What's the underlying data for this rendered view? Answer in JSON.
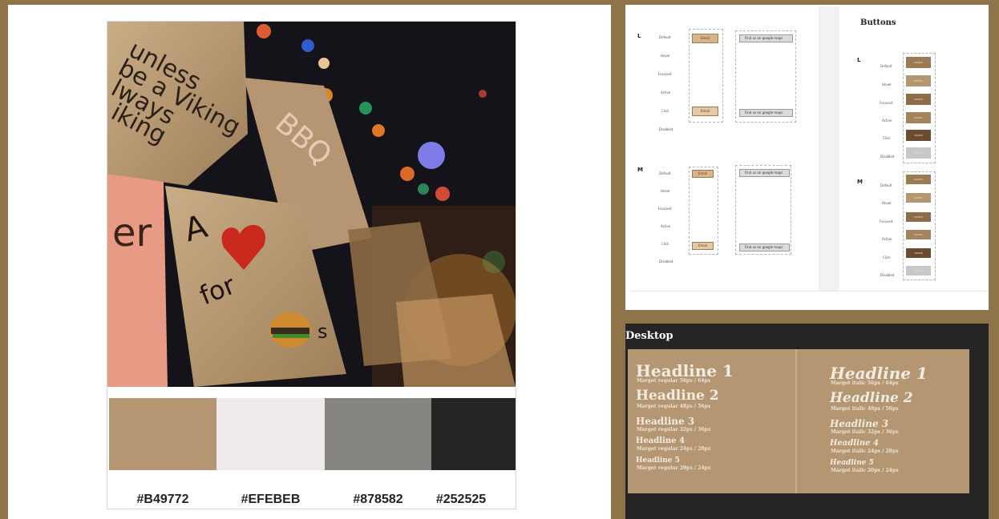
{
  "palette": {
    "swatches": [
      {
        "hex": "#B49772",
        "color": "#b49772"
      },
      {
        "hex": "#EFEBEB",
        "color": "#efebeb"
      },
      {
        "hex": "#878582",
        "color": "#878582"
      },
      {
        "hex": "#252525",
        "color": "#252525"
      }
    ]
  },
  "buttons_spec": {
    "title": "Buttons",
    "left_sizes": [
      {
        "size": "L",
        "states": [
          "Default",
          "Hover",
          "Focused",
          "Active",
          "Click",
          "Disabled"
        ],
        "primary_label": "Email",
        "secondary_label": "Find us on google maps"
      },
      {
        "size": "M",
        "states": [
          "Default",
          "Hover",
          "Focused",
          "Active",
          "Click",
          "Disabled"
        ],
        "primary_label": "Email",
        "secondary_label": "Find us on google maps"
      }
    ],
    "right_sizes": [
      {
        "size": "L",
        "states": [
          "Default",
          "Hover",
          "Focused",
          "Active",
          "Click",
          "Disabled"
        ],
        "button_label": "ORDER"
      },
      {
        "size": "M",
        "states": [
          "Default",
          "Hover",
          "Focused",
          "Active",
          "Click",
          "Disabled"
        ],
        "button_label": "ORDER"
      }
    ],
    "button_colors": [
      "#9b7a56",
      "#b49772",
      "#8c6c4a",
      "#a3845f",
      "#6a4c30",
      "#c8c8c8"
    ]
  },
  "typography": {
    "label": "Desktop",
    "regular": [
      {
        "name": "Headline 1",
        "spec": "Margot regular 56px / 64px"
      },
      {
        "name": "Headline 2",
        "spec": "Margot regular 48px / 56px"
      },
      {
        "name": "Headline 3",
        "spec": "Margot regular 32px / 36px"
      },
      {
        "name": "Headline 4",
        "spec": "Margot regular 24px / 28px"
      },
      {
        "name": "Headline 5",
        "spec": "Margot regular 20px / 24px"
      }
    ],
    "italic": [
      {
        "name": "Headline 1",
        "spec": "Margot italic 56px / 64px"
      },
      {
        "name": "Headline 2",
        "spec": "Margot italic 48px / 56px"
      },
      {
        "name": "Headline 3",
        "spec": "Margot italic 32px / 36px"
      },
      {
        "name": "Headline 4",
        "spec": "Margot italic 24px / 28px"
      },
      {
        "name": "Headline 5",
        "spec": "Margot italic 20px / 24px"
      }
    ]
  }
}
